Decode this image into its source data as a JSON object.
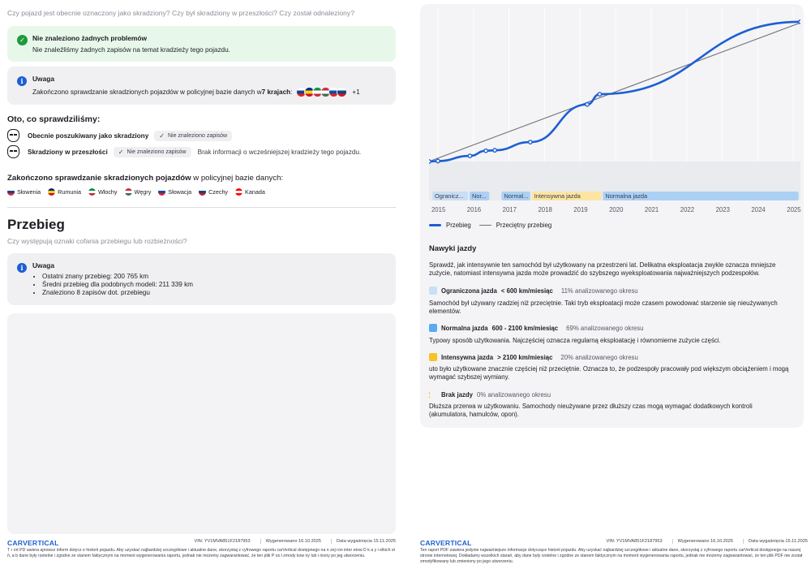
{
  "left": {
    "stolen_question": "Czy pojazd jest obecnie oznaczony jako skradziony? Czy był skradziony w przeszłości? Czy został odnaleziony?",
    "ok_card": {
      "title": "Nie znaleziono żadnych problemów",
      "text": "Nie znaleźliśmy żadnych zapisów na temat kradzieży tego pojazdu."
    },
    "note_card": {
      "title": "Uwaga",
      "text_before": "Zakończono sprawdzanie skradzionych pojazdów w policyjnej bazie danych w ",
      "text_bold": "7 krajach",
      "text_after": ":",
      "more": "+1"
    },
    "checked_heading": "Oto, co sprawdziliśmy:",
    "checks": [
      {
        "label": "Obecnie poszukiwany jako skradziony",
        "badge": "Nie znaleziono zapisów",
        "extra": ""
      },
      {
        "label": "Skradziony w przeszłości",
        "badge": "Nie znaleziono zapisów",
        "extra": "Brak informacji o wcześniejszej kradzieży tego pojazdu."
      }
    ],
    "countries_heading_bold": "Zakończono sprawdzanie skradzionych pojazdów",
    "countries_heading_rest": " w policyjnej bazie danych:",
    "countries": [
      {
        "name": "Słowenia",
        "colors": [
          "#ffffff",
          "#1c3f94",
          "#e2231a"
        ]
      },
      {
        "name": "Rumunia",
        "colors": [
          "#002b7f",
          "#fcd116",
          "#ce1126"
        ]
      },
      {
        "name": "Włochy",
        "colors": [
          "#009246",
          "#ffffff",
          "#ce2b37"
        ]
      },
      {
        "name": "Węgry",
        "colors": [
          "#cd2a3e",
          "#ffffff",
          "#436f4d"
        ]
      },
      {
        "name": "Słowacja",
        "colors": [
          "#ffffff",
          "#0b4ea2",
          "#ee1c25"
        ]
      },
      {
        "name": "Czechy",
        "colors": [
          "#ffffff",
          "#11457e",
          "#d7141a"
        ]
      },
      {
        "name": "Kanada",
        "colors": [
          "#ff0000",
          "#ffffff",
          "#ff0000"
        ]
      }
    ],
    "mileage_title": "Przebieg",
    "mileage_question": "Czy występują oznaki cofania przebiegu lub rozbieżności?",
    "mileage_note": {
      "title": "Uwaga",
      "items": [
        "Ostatni znany przebieg: 200 765 km",
        "Średni przebieg dla podobnych modeli: 211 339 km",
        "Znaleziono 8 zapisów dot. przebiegu"
      ]
    }
  },
  "footer": {
    "logo": "CARVERTICAL",
    "vin": "VIN:  YV1MVA851F2187953",
    "generated": "Wygenerowano  16.10.2025",
    "expires": "Data wygaśnięcia  15.11.2025",
    "left_text": "T  r  ort  PD  awiera  ajnowsz  inform     dotycz  e historii pojazdu. Aby uzyskać najbardziej szczegółowe i aktualne dane, skorzystaj z cyfrowego raportu carVertical dostępnego na  n  zej  ron   inter  etow   D  k  a  y  i  elkich  st  ń,  a b  dane  były rzetelne i zgodne ze stanem faktycznym na moment wygenerowania raportu, jednak nie możemy zagwarantować, że ten plik  P   os   ł zmody  kow  ny  lub  i   niony po jeg  utworzeniu.",
    "right_text": "Ten raport PDF zawiera jedynie najważniejsze informacje dotyczące historii pojazdu. Aby uzyskać najbardziej szczegółowe i aktualne dane, skorzystaj z cyfrowego raportu carVertical dostępnego na naszej stronie internetowej. Dokładamy wszelkich starań, aby dane były rzetelne i zgodne ze stanem faktycznym na moment wygenerowania raportu, jednak nie możemy zagwarantować, że ten plik PDF nie został zmodyfikowany lub zmieniony po jego utworzeniu."
  },
  "chart_data": {
    "type": "line",
    "x_ticks": [
      "2015",
      "2016",
      "2017",
      "2018",
      "2019",
      "2020",
      "2021",
      "2022",
      "2023",
      "2024",
      "2025"
    ],
    "series": [
      {
        "name": "Przebieg",
        "color": "#1c5fd4",
        "x": [
          2014.75,
          2015.0,
          2015.9,
          2016.35,
          2016.6,
          2017.6,
          2019.2,
          2019.55,
          2025.2
        ],
        "y": [
          0.0,
          0.002,
          0.024,
          0.046,
          0.048,
          0.083,
          0.244,
          0.288,
          0.598
        ]
      },
      {
        "name": "Przeciętny przebieg",
        "color": "#6f7079",
        "x": [
          2014.75,
          2025.2
        ],
        "y": [
          0.0,
          0.594
        ]
      }
    ],
    "segments": [
      {
        "label": "Ograniczona jazda",
        "from": 2014.75,
        "to": 2015.8,
        "color": "#c8dff5"
      },
      {
        "label": "Normalna jazda",
        "from": 2015.8,
        "to": 2016.4,
        "color": "#abd0f4"
      },
      {
        "label": "Normalna jazda",
        "from": 2016.7,
        "to": 2017.55,
        "color": "#abd0f4"
      },
      {
        "label": "Intensywna jazda",
        "from": 2017.55,
        "to": 2019.55,
        "color": "#fce5a3"
      },
      {
        "label": "Normalna jazda",
        "from": 2019.55,
        "to": 2025.1,
        "color": "#abd0f4"
      }
    ],
    "segment_labels_shown": [
      "Ogranicz...",
      "Nor...",
      "Normal...",
      "Intensywna jazda",
      "Normalna jazda"
    ]
  },
  "right": {
    "driving_title": "Nawyki jazdy",
    "driving_intro": "Sprawdź, jak intensywnie ten samochód był użytkowany na przestrzeni lat. Delikatna eksploatacja zwykle oznacza mniejsze zużycie, natomiast intensywna jazda może prowadzić do szybszego wyeksploatowania najważniejszych podzespołów.",
    "levels": [
      {
        "name": "Ograniczona jazda",
        "range": "< 600 km/miesiąc",
        "pct": "11% analizowanego okresu",
        "color": "#c6e1f7",
        "desc": "Samochód był używany rzadziej niż przeciętnie. Taki tryb eksploatacji może czasem powodować starzenie się nieużywanych elementów."
      },
      {
        "name": "Normalna jazda",
        "range": "600 - 2100 km/miesiąc",
        "pct": "69% analizowanego okresu",
        "color": "#5aaaf0",
        "desc": "Typowy sposób użytkowania. Najczęściej oznacza regularną eksploatację i równomierne zużycie części."
      },
      {
        "name": "Intensywna jazda",
        "range": "> 2100 km/miesiąc",
        "pct": "20% analizowanego okresu",
        "color": "#f7c325",
        "desc": "uto było użytkowane znacznie częściej niż przeciętnie. Oznacza to, że podzespoły pracowały pod większym obciążeniem i mogą wymagać szybszej wymiany."
      },
      {
        "name": "Brak jazdy",
        "range": "",
        "pct": "0% analizowanego okresu",
        "color": "#f5c331",
        "desc": "Dłuższa przerwa w użytkowaniu. Samochody nieużywane przez dłuższy czas mogą wymagać dodatkowych kontroli (akumulatora, hamulców, opon)."
      }
    ]
  }
}
